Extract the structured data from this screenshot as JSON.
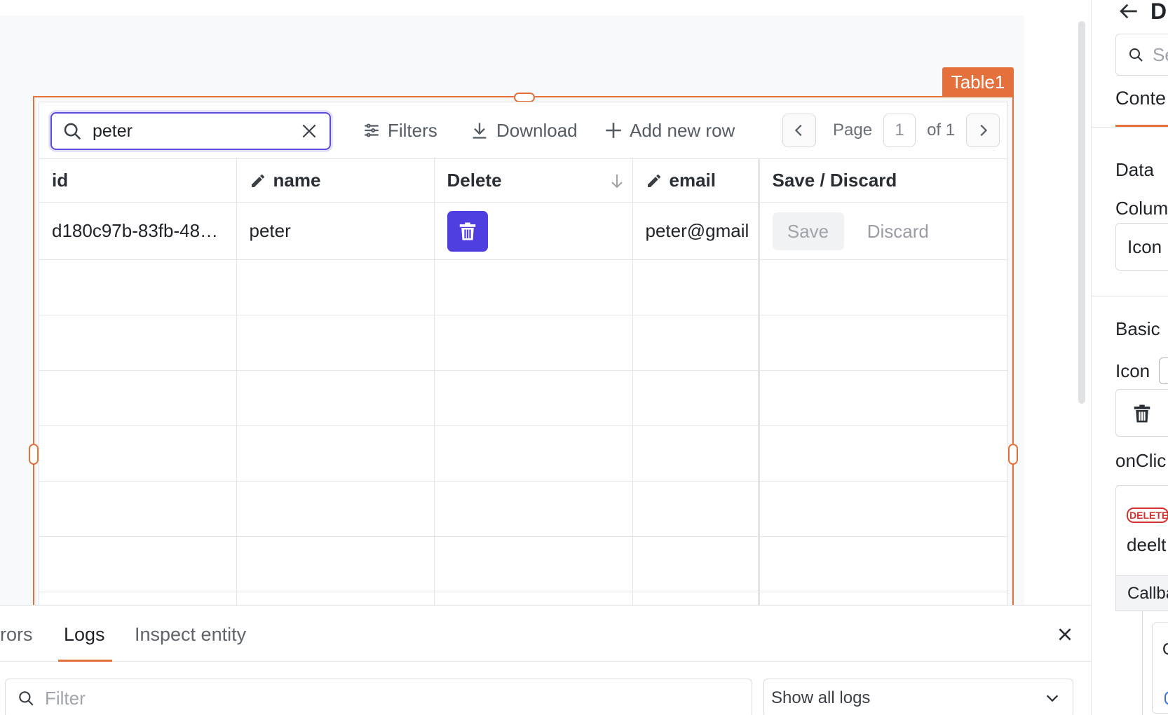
{
  "table": {
    "widget_label": "Table1",
    "search": {
      "value": "peter"
    },
    "toolbar": {
      "filters_label": "Filters",
      "download_label": "Download",
      "add_row_label": "Add new row"
    },
    "pager": {
      "page_label": "Page",
      "page_number": "1",
      "of_label": "of 1"
    },
    "columns": {
      "id": "id",
      "name": "name",
      "delete": "Delete",
      "email": "email",
      "save_discard": "Save / Discard"
    },
    "rows": [
      {
        "id": "d180c97b-83fb-48…",
        "name": "peter",
        "email": "peter@gmail",
        "save_label": "Save",
        "discard_label": "Discard"
      }
    ]
  },
  "console": {
    "tabs": [
      "rors",
      "Logs",
      "Inspect entity"
    ],
    "active_tab": "Logs",
    "filter_placeholder": "Filter",
    "log_level": "Show all logs"
  },
  "inspector": {
    "title": "D",
    "search_placeholder": "Se",
    "tab": "Conte",
    "section_data": "Data",
    "column_label": "Colum",
    "column_value": "Icon",
    "section_basic": "Basic",
    "icon_label": "Icon",
    "icon_value": "t",
    "onclick_label": "onClic",
    "delete_tag": "DELETE",
    "query_name": "deelt",
    "callback_label": "Callba",
    "nested_label": "Or",
    "nested_tag": "G"
  },
  "colors": {
    "accent": "#e4703b",
    "primary": "#4f3fe0",
    "danger": "#d3322f"
  }
}
